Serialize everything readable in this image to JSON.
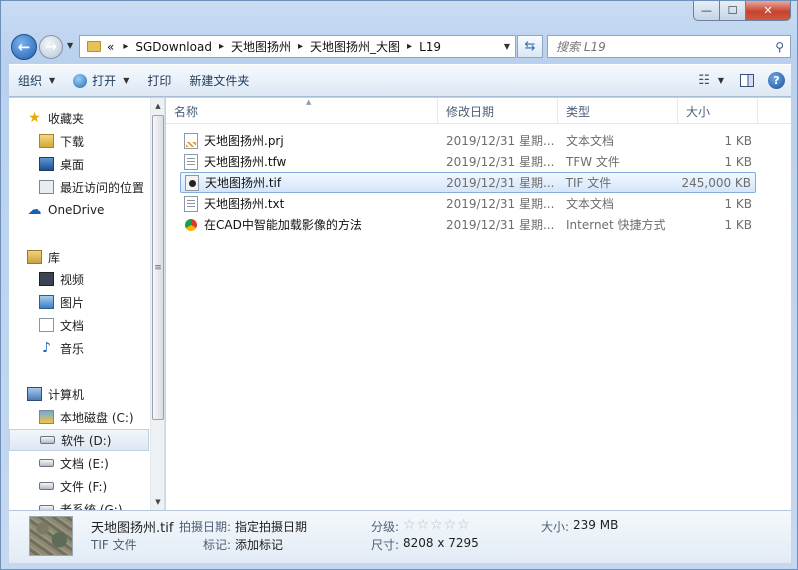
{
  "window": {
    "caption": {
      "minimize": "—",
      "maximize": "☐",
      "close": "✕"
    }
  },
  "address": {
    "overflow": "«",
    "crumbs": [
      "SGDownload",
      "天地图扬州",
      "天地图扬州_大图",
      "L19"
    ]
  },
  "search": {
    "placeholder": "搜索 L19"
  },
  "toolbar": {
    "organize": "组织",
    "open": "打开",
    "print": "打印",
    "new_folder": "新建文件夹"
  },
  "nav": {
    "favorites": "收藏夹",
    "downloads": "下载",
    "desktop": "桌面",
    "recent": "最近访问的位置",
    "onedrive": "OneDrive",
    "libraries": "库",
    "videos": "视频",
    "pictures": "图片",
    "documents": "文档",
    "music": "音乐",
    "computer": "计算机",
    "drive_c": "本地磁盘 (C:)",
    "drive_d": "软件 (D:)",
    "drive_e": "文档 (E:)",
    "drive_f": "文件 (F:)",
    "drive_g": "老系统 (G:)"
  },
  "columns": {
    "name": "名称",
    "date": "修改日期",
    "type": "类型",
    "size": "大小"
  },
  "files": [
    {
      "name": "天地图扬州.prj",
      "date": "2019/12/31 星期...",
      "type": "文本文档",
      "size": "1 KB",
      "icon": "prj"
    },
    {
      "name": "天地图扬州.tfw",
      "date": "2019/12/31 星期...",
      "type": "TFW 文件",
      "size": "1 KB",
      "icon": "txt"
    },
    {
      "name": "天地图扬州.tif",
      "date": "2019/12/31 星期...",
      "type": "TIF 文件",
      "size": "245,000 KB",
      "icon": "tif"
    },
    {
      "name": "天地图扬州.txt",
      "date": "2019/12/31 星期...",
      "type": "文本文档",
      "size": "1 KB",
      "icon": "txt"
    },
    {
      "name": "在CAD中智能加载影像的方法",
      "date": "2019/12/31 星期...",
      "type": "Internet 快捷方式",
      "size": "1 KB",
      "icon": "url"
    }
  ],
  "details": {
    "filename": "天地图扬州.tif",
    "filetype": "TIF 文件",
    "date_taken_label": "拍摄日期:",
    "date_taken_value": "指定拍摄日期",
    "tags_label": "标记:",
    "tags_value": "添加标记",
    "rating_label": "分级:",
    "rating": 0,
    "size_label": "大小:",
    "size_value": "239 MB",
    "dimensions_label": "尺寸:",
    "dimensions_value": "8208 x 7295"
  }
}
